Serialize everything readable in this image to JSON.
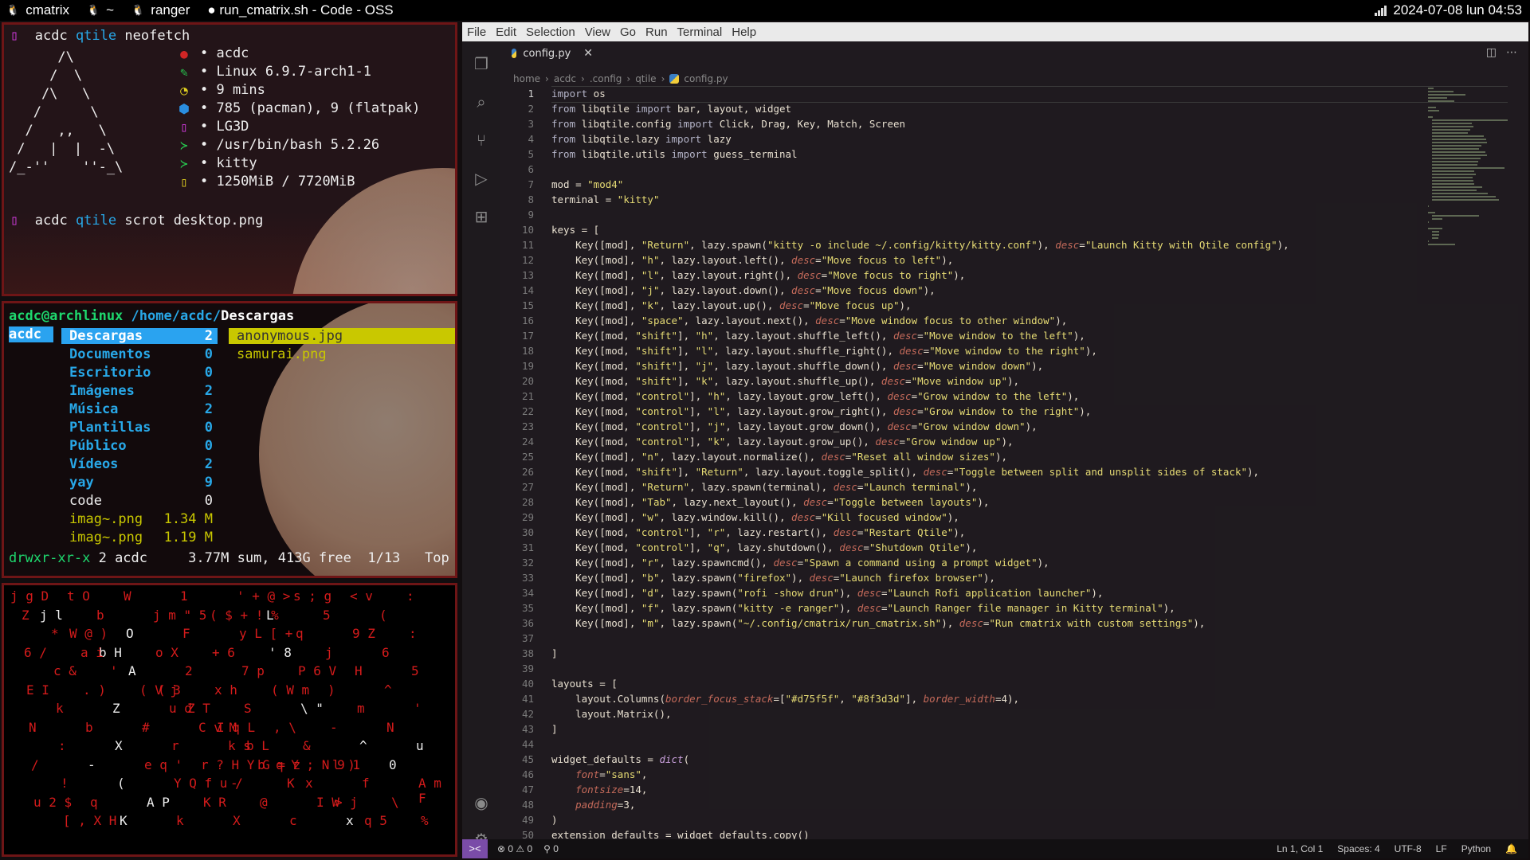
{
  "topbar": {
    "tasks": [
      {
        "icon": "tux-icon",
        "label": "cmatrix"
      },
      {
        "icon": "tux-icon",
        "label": "~"
      },
      {
        "icon": "tux-icon",
        "label": "ranger"
      },
      {
        "icon": "dot-icon",
        "label": "● run_cmatrix.sh - Code - OSS"
      }
    ],
    "clock": "2024-07-08 lun 04:53"
  },
  "term1": {
    "prompt_user": "acdc",
    "prompt_dir": "qtile",
    "cmd1": "neofetch",
    "ascii": "      /\\\n     /  \\\n    /\\   \\\n   /      \\\n  /   ,,   \\\n /   |  |  -\\\n/_-''    ''-_\\",
    "info": [
      {
        "icon": "debian-icon",
        "color": "#d02525",
        "text": "• acdc"
      },
      {
        "icon": "pencil-icon",
        "color": "#28c850",
        "text": "• Linux 6.9.7-arch1-1"
      },
      {
        "icon": "clock-icon",
        "color": "#e0d020",
        "text": "• 9 mins"
      },
      {
        "icon": "package-icon",
        "color": "#2a8ee0",
        "text": "• 785 (pacman), 9 (flatpak)"
      },
      {
        "icon": "window-icon",
        "color": "#d33be0",
        "text": "• LG3D"
      },
      {
        "icon": "terminal-icon",
        "color": "#28c850",
        "text": "• /usr/bin/bash 5.2.26"
      },
      {
        "icon": "terminal-icon",
        "color": "#28c850",
        "text": "• kitty"
      },
      {
        "icon": "memory-icon",
        "color": "#e0d020",
        "text": "• 1250MiB / 7720MiB"
      }
    ],
    "cmd2": "scrot desktop.png"
  },
  "term2": {
    "header_user": "acdc@archlinux",
    "header_path": "/home/acdc/",
    "header_dir": "Descargas",
    "parent": "acdc",
    "dirs": [
      {
        "name": "Descargas",
        "count": "2"
      },
      {
        "name": "Documentos",
        "count": "0"
      },
      {
        "name": "Escritorio",
        "count": "0"
      },
      {
        "name": "Imágenes",
        "count": "2"
      },
      {
        "name": "Música",
        "count": "2"
      },
      {
        "name": "Plantillas",
        "count": "0"
      },
      {
        "name": "Público",
        "count": "0"
      },
      {
        "name": "Vídeos",
        "count": "2"
      },
      {
        "name": "yay",
        "count": "9"
      },
      {
        "name": "code",
        "count": "0"
      },
      {
        "name": "imag~.png",
        "count": "1.34 M"
      },
      {
        "name": "imag~.png",
        "count": "1.19 M"
      }
    ],
    "files": [
      "anonymous.jpg",
      "samurai.png"
    ],
    "status": "drwxr-xr-x 2 acdc     3.77M sum, 413G free  1/13   Top"
  },
  "vscode": {
    "menu": [
      "File",
      "Edit",
      "Selection",
      "View",
      "Go",
      "Run",
      "Terminal",
      "Help"
    ],
    "tab": "config.py",
    "breadcrumb": [
      "home",
      "acdc",
      ".config",
      "qtile",
      "config.py"
    ],
    "code_lines": [
      "import os",
      "from libqtile import bar, layout, widget",
      "from libqtile.config import Click, Drag, Key, Match, Screen",
      "from libqtile.lazy import lazy",
      "from libqtile.utils import guess_terminal",
      "",
      "mod = \"mod4\"",
      "terminal = \"kitty\"",
      "",
      "keys = [",
      "    Key([mod], \"Return\", lazy.spawn(\"kitty -o include ~/.config/kitty/kitty.conf\"), desc=\"Launch Kitty with Qtile config\"),",
      "    Key([mod], \"h\", lazy.layout.left(), desc=\"Move focus to left\"),",
      "    Key([mod], \"l\", lazy.layout.right(), desc=\"Move focus to right\"),",
      "    Key([mod], \"j\", lazy.layout.down(), desc=\"Move focus down\"),",
      "    Key([mod], \"k\", lazy.layout.up(), desc=\"Move focus up\"),",
      "    Key([mod], \"space\", lazy.layout.next(), desc=\"Move window focus to other window\"),",
      "    Key([mod, \"shift\"], \"h\", lazy.layout.shuffle_left(), desc=\"Move window to the left\"),",
      "    Key([mod, \"shift\"], \"l\", lazy.layout.shuffle_right(), desc=\"Move window to the right\"),",
      "    Key([mod, \"shift\"], \"j\", lazy.layout.shuffle_down(), desc=\"Move window down\"),",
      "    Key([mod, \"shift\"], \"k\", lazy.layout.shuffle_up(), desc=\"Move window up\"),",
      "    Key([mod, \"control\"], \"h\", lazy.layout.grow_left(), desc=\"Grow window to the left\"),",
      "    Key([mod, \"control\"], \"l\", lazy.layout.grow_right(), desc=\"Grow window to the right\"),",
      "    Key([mod, \"control\"], \"j\", lazy.layout.grow_down(), desc=\"Grow window down\"),",
      "    Key([mod, \"control\"], \"k\", lazy.layout.grow_up(), desc=\"Grow window up\"),",
      "    Key([mod], \"n\", lazy.layout.normalize(), desc=\"Reset all window sizes\"),",
      "    Key([mod, \"shift\"], \"Return\", lazy.layout.toggle_split(), desc=\"Toggle between split and unsplit sides of stack\"),",
      "    Key([mod], \"Return\", lazy.spawn(terminal), desc=\"Launch terminal\"),",
      "    Key([mod], \"Tab\", lazy.next_layout(), desc=\"Toggle between layouts\"),",
      "    Key([mod], \"w\", lazy.window.kill(), desc=\"Kill focused window\"),",
      "    Key([mod, \"control\"], \"r\", lazy.restart(), desc=\"Restart Qtile\"),",
      "    Key([mod, \"control\"], \"q\", lazy.shutdown(), desc=\"Shutdown Qtile\"),",
      "    Key([mod], \"r\", lazy.spawncmd(), desc=\"Spawn a command using a prompt widget\"),",
      "    Key([mod], \"b\", lazy.spawn(\"firefox\"), desc=\"Launch firefox browser\"),",
      "    Key([mod], \"d\", lazy.spawn(\"rofi -show drun\"), desc=\"Launch Rofi application launcher\"),",
      "    Key([mod], \"f\", lazy.spawn(\"kitty -e ranger\"), desc=\"Launch Ranger file manager in Kitty terminal\"),",
      "    Key([mod], \"m\", lazy.spawn(\"~/.config/cmatrix/run_cmatrix.sh\"), desc=\"Run cmatrix with custom settings\"),",
      "",
      "]",
      "",
      "layouts = [",
      "    layout.Columns(border_focus_stack=[\"#d75f5f\", \"#8f3d3d\"], border_width=4),",
      "    layout.Matrix(),",
      "]",
      "",
      "widget_defaults = dict(",
      "    font=\"sans\",",
      "    fontsize=14,",
      "    padding=3,",
      ")",
      "extension_defaults = widget_defaults.copy()"
    ],
    "status": {
      "remote": "><",
      "errors": "⊗ 0 ⚠ 0",
      "ports": "⚲ 0",
      "position": "Ln 1, Col 1",
      "spaces": "Spaces: 4",
      "encoding": "UTF-8",
      "eol": "LF",
      "language": "Python"
    }
  },
  "matrix_chars": [
    {
      "t": "j g D",
      "c": "r"
    },
    {
      "t": "t O",
      "c": "r"
    },
    {
      "t": "W",
      "c": "r"
    },
    {
      "t": "1",
      "c": "r"
    },
    {
      "t": "' + @ >",
      "c": "r"
    },
    {
      "t": "s ; g",
      "c": "r"
    },
    {
      "t": "< v",
      "c": "r"
    },
    {
      "t": ":",
      "c": "r"
    },
    {
      "t": "j l",
      "c": "w"
    },
    {
      "t": "b",
      "c": "r"
    },
    {
      "t": "j m \" 5",
      "c": "r"
    },
    {
      "t": "( $ + ! %",
      "c": "r"
    },
    {
      "t": "L",
      "c": "w"
    },
    {
      "t": "5",
      "c": "r"
    },
    {
      "t": "(",
      "c": "r"
    },
    {
      "t": "Z",
      "c": "r"
    },
    {
      "t": "W @ )",
      "c": "r"
    },
    {
      "t": "O",
      "c": "w"
    },
    {
      "t": "F",
      "c": "r"
    },
    {
      "t": "y L [ +",
      "c": "r"
    },
    {
      "t": "q",
      "c": "r"
    },
    {
      "t": "9 Z",
      "c": "r"
    },
    {
      "t": ":",
      "c": "r"
    },
    {
      "t": "*",
      "c": "r"
    },
    {
      "t": "b H",
      "c": "w"
    },
    {
      "t": "o X",
      "c": "r"
    },
    {
      "t": "+ 6",
      "c": "r"
    },
    {
      "t": "' 8",
      "c": "w"
    },
    {
      "t": "j",
      "c": "r"
    },
    {
      "t": "6",
      "c": "r"
    },
    {
      "t": "6 /",
      "c": "r"
    },
    {
      "t": "a i",
      "c": "r"
    },
    {
      "t": "A",
      "c": "w"
    },
    {
      "t": "2",
      "c": "r"
    },
    {
      "t": "7 p",
      "c": "r"
    },
    {
      "t": "P 6 V",
      "c": "r"
    },
    {
      "t": "H",
      "c": "r"
    },
    {
      "t": "5",
      "c": "r"
    },
    {
      "t": "c &",
      "c": "r"
    },
    {
      "t": "'",
      "c": "r"
    },
    {
      "t": "( 3",
      "c": "r"
    },
    {
      "t": "x h",
      "c": "r"
    },
    {
      "t": "( W m",
      "c": "r"
    },
    {
      "t": ")",
      "c": "r"
    },
    {
      "t": "^",
      "c": "r"
    },
    {
      "t": "E I",
      "c": "r"
    },
    {
      "t": ". )",
      "c": "r"
    },
    {
      "t": "( V j",
      "c": "r"
    },
    {
      "t": "Z T",
      "c": "r"
    },
    {
      "t": "S",
      "c": "r"
    },
    {
      "t": "\\ \"",
      "c": "w"
    },
    {
      "t": "m",
      "c": "r"
    },
    {
      "t": "'",
      "c": "r"
    },
    {
      "t": "k",
      "c": "r"
    },
    {
      "t": "Z",
      "c": "w"
    },
    {
      "t": "u d",
      "c": "r"
    },
    {
      "t": "I q L",
      "c": "r"
    },
    {
      "t": ", \\",
      "c": "r"
    },
    {
      "t": "-",
      "c": "r"
    },
    {
      "t": "N",
      "c": "r"
    },
    {
      "t": "N",
      "c": "r"
    },
    {
      "t": "b",
      "c": "r"
    },
    {
      "t": "#",
      "c": "r"
    },
    {
      "t": "C v M",
      "c": "r"
    },
    {
      "t": "b L",
      "c": "r"
    },
    {
      "t": "&",
      "c": "r"
    },
    {
      "t": "^",
      "c": "w"
    },
    {
      "t": "u",
      "c": "w"
    },
    {
      "t": ":",
      "c": "r"
    },
    {
      "t": "X",
      "c": "w"
    },
    {
      "t": "r",
      "c": "r"
    },
    {
      "t": "k s",
      "c": "r"
    },
    {
      "t": "q Y ; N 9 1",
      "c": "r"
    },
    {
      "t": "l )",
      "c": "r"
    },
    {
      "t": "0",
      "c": "w"
    },
    {
      "t": "/",
      "c": "r"
    },
    {
      "t": "-",
      "c": "w"
    },
    {
      "t": "e q '",
      "c": "r"
    },
    {
      "t": "r ? H Y G = z",
      "c": "r"
    },
    {
      "t": "b",
      "c": "r"
    },
    {
      "t": "x",
      "c": "r"
    },
    {
      "t": "f",
      "c": "r"
    },
    {
      "t": "A m F",
      "c": "r"
    },
    {
      "t": "!",
      "c": "r"
    },
    {
      "t": "(",
      "c": "w"
    },
    {
      "t": "Y Q f u /",
      "c": "r"
    },
    {
      "t": "-",
      "c": "r"
    },
    {
      "t": "K",
      "c": "r"
    },
    {
      "t": "> j",
      "c": "r"
    },
    {
      "t": "\\",
      "c": "r"
    },
    {
      "t": "u 2 $",
      "c": "r"
    },
    {
      "t": "q",
      "c": "r"
    },
    {
      "t": "A P",
      "c": "w"
    },
    {
      "t": "K R",
      "c": "r"
    },
    {
      "t": "@",
      "c": "r"
    },
    {
      "t": "I W",
      "c": "r"
    },
    {
      "t": "q 5",
      "c": "r"
    },
    {
      "t": "%",
      "c": "r"
    },
    {
      "t": "[ , X H",
      "c": "r"
    },
    {
      "t": "K",
      "c": "w"
    },
    {
      "t": "k",
      "c": "r"
    },
    {
      "t": "X",
      "c": "r"
    },
    {
      "t": "c",
      "c": "r"
    },
    {
      "t": "x",
      "c": "w"
    }
  ]
}
